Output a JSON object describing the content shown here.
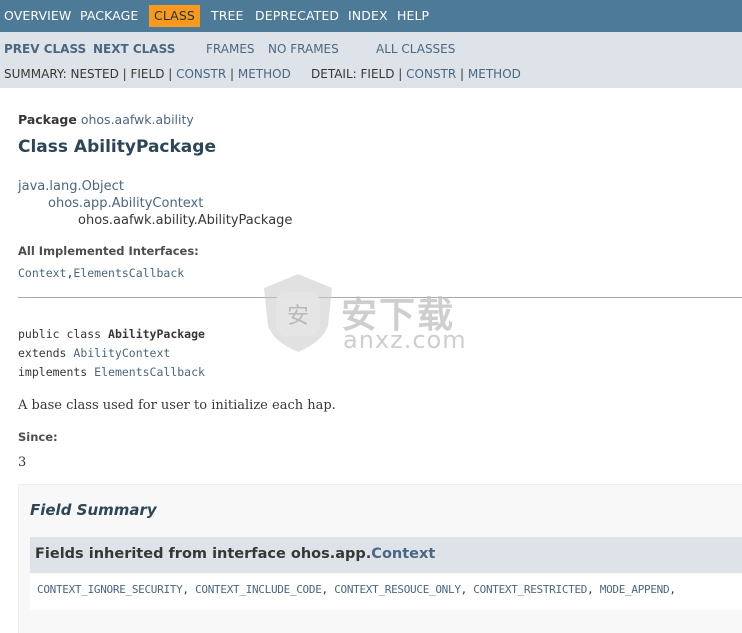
{
  "top_nav": {
    "overview": "OVERVIEW",
    "package": "PACKAGE",
    "class": "CLASS",
    "tree": "TREE",
    "deprecated": "DEPRECATED",
    "index": "INDEX",
    "help": "HELP"
  },
  "sub_nav": {
    "prev_class": "PREV CLASS",
    "next_class": "NEXT CLASS",
    "frames": "FRAMES",
    "no_frames": "NO FRAMES",
    "all_classes": "ALL CLASSES",
    "summary_label": "SUMMARY: NESTED | FIELD | ",
    "summary_constr": "CONSTR",
    "summary_sep": " | ",
    "summary_method": "METHOD",
    "detail_label": "DETAIL: FIELD | ",
    "detail_constr": "CONSTR",
    "detail_sep": " | ",
    "detail_method": "METHOD"
  },
  "header": {
    "package_label": "Package",
    "package_name": "ohos.aafwk.ability",
    "class_title": "Class AbilityPackage"
  },
  "inheritance": {
    "level0": "java.lang.Object",
    "level1": "ohos.app.AbilityContext",
    "level2": "ohos.aafwk.ability.AbilityPackage"
  },
  "interfaces": {
    "label": "All Implemented Interfaces:",
    "items": [
      "Context",
      "ElementsCallback"
    ],
    "separator": ","
  },
  "declaration": {
    "line1_prefix": "public class ",
    "line1_name": "AbilityPackage",
    "line2_prefix": "extends ",
    "line2_link": "AbilityContext",
    "line3_prefix": "implements ",
    "line3_link": "ElementsCallback"
  },
  "description": "A base class used for user to initialize each hap.",
  "since": {
    "label": "Since:",
    "value": "3"
  },
  "field_summary": {
    "title": "Field Summary",
    "inherited_prefix": "Fields inherited from interface ohos.app.",
    "inherited_link": "Context",
    "fields": [
      "CONTEXT_IGNORE_SECURITY",
      "CONTEXT_INCLUDE_CODE",
      "CONTEXT_RESOUCE_ONLY",
      "CONTEXT_RESTRICTED",
      "MODE_APPEND"
    ],
    "field_separator": ", "
  },
  "watermark": {
    "text": "安下载",
    "sub": "anxz.com",
    "shield_glyph": "安"
  },
  "colors": {
    "nav_bg": "#4d7a97",
    "active_tab": "#f8981d",
    "subnav_bg": "#dee3e9",
    "link": "#4a6782"
  }
}
